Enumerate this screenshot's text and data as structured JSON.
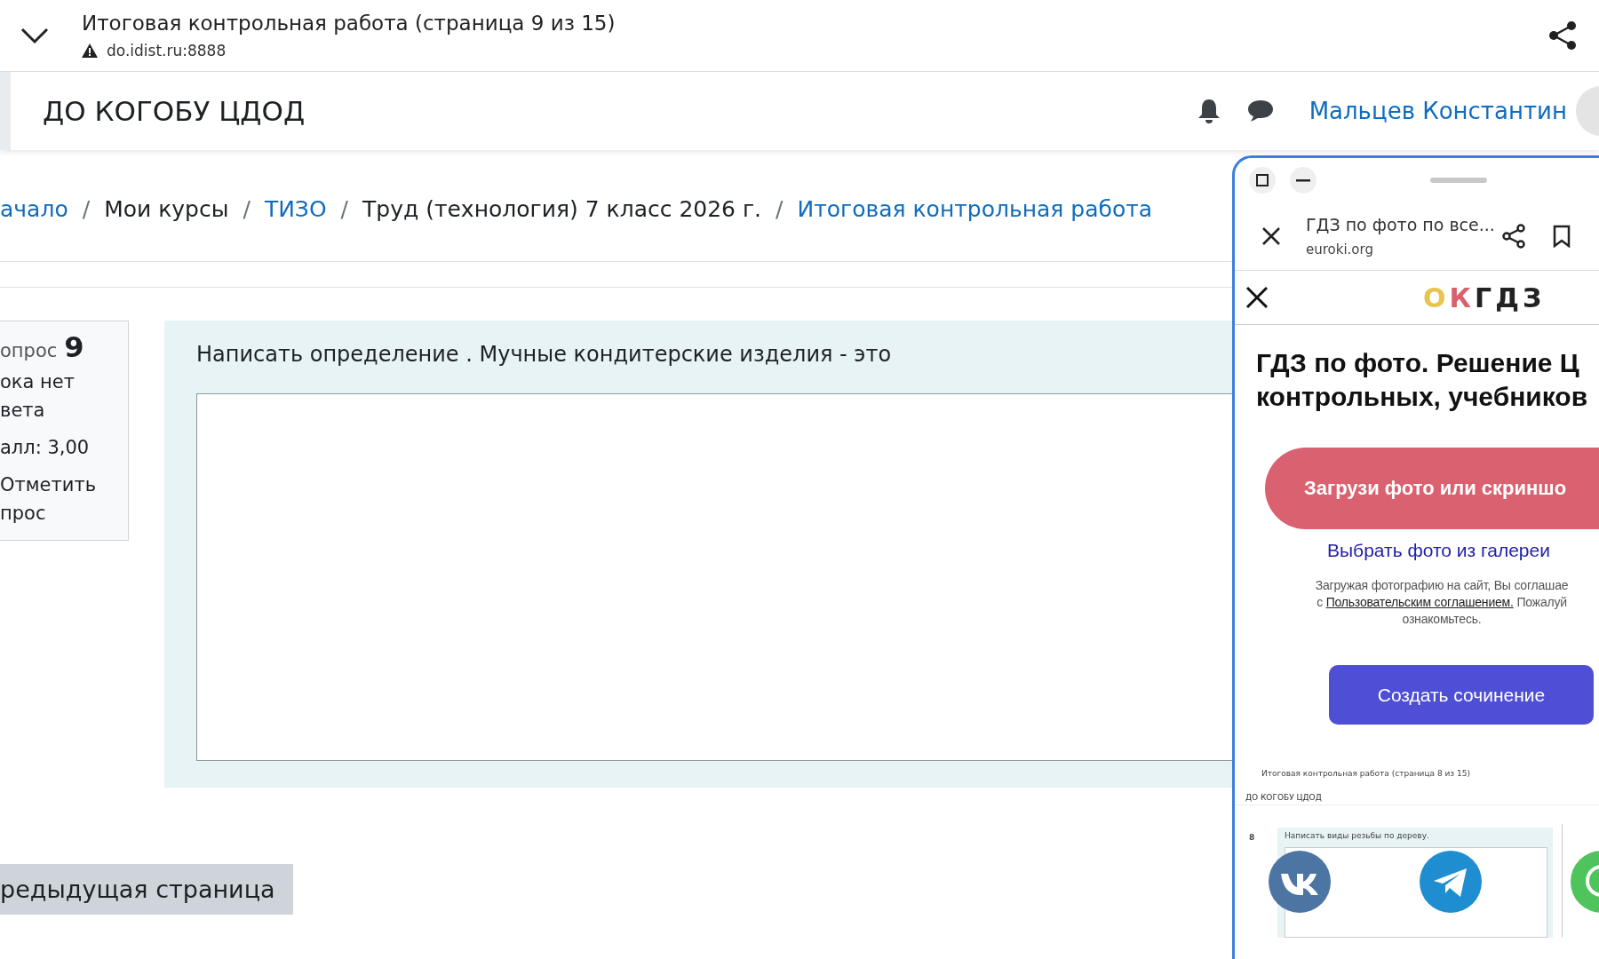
{
  "browser_bar": {
    "title": "Итоговая контрольная работа (страница 9 из 15)",
    "url": "do.idist.ru:8888"
  },
  "header": {
    "site_name": "ДО КОГОБУ ЦДОД",
    "user_name": "Мальцев Константин"
  },
  "breadcrumb": [
    {
      "kind": "link",
      "text": "ачало"
    },
    {
      "kind": "separator",
      "text": "/"
    },
    {
      "kind": "text",
      "text": "Мои курсы"
    },
    {
      "kind": "separator",
      "text": "/"
    },
    {
      "kind": "link",
      "text": "ТИЗО"
    },
    {
      "kind": "separator",
      "text": "/"
    },
    {
      "kind": "text",
      "text": "Труд (технология) 7 класс 2026 г."
    },
    {
      "kind": "separator",
      "text": "/"
    },
    {
      "kind": "link",
      "text": "Итоговая контрольная работа"
    }
  ],
  "question_info": {
    "label": "опрос",
    "number": "9",
    "status_lines": [
      "ока нет",
      "вета"
    ],
    "score": "алл: 3,00",
    "flag_lines": [
      "Отметить",
      "прос"
    ]
  },
  "question": {
    "text": "Написать определение . Мучные  кондитерские изделия - это"
  },
  "prev_button": "редыдущая страница",
  "popup": {
    "tab_title": "ГДЗ по фото по все...",
    "tab_url": "euroki.org",
    "logo": [
      {
        "text": "О",
        "color": "#e8c44f"
      },
      {
        "text": "К",
        "color": "#d9616f"
      },
      {
        "text": "ГДЗ",
        "color": "#222222"
      }
    ],
    "heading_lines": [
      "ГДЗ по фото. Решение Ц",
      "контрольных, учебников"
    ],
    "upload_button": "Загрузи фото или скриншо",
    "gallery_link": "Выбрать фото из галереи",
    "consent_before": "Загружая фотографию на сайт, Вы соглашае",
    "consent_prefix": "с",
    "consent_link": "Пользовательским соглашением.",
    "consent_after": "Пожалуй",
    "consent_end": "ознакомьтесь.",
    "essay_button": "Создать сочинение",
    "thumbnail": {
      "title": "Итоговая контрольная работа (страница 8 из 15)",
      "site_name": "ДО КОГОБУ ЦДОД",
      "question_number": "8",
      "question_text": "Написать виды резьбы по дереву."
    }
  }
}
